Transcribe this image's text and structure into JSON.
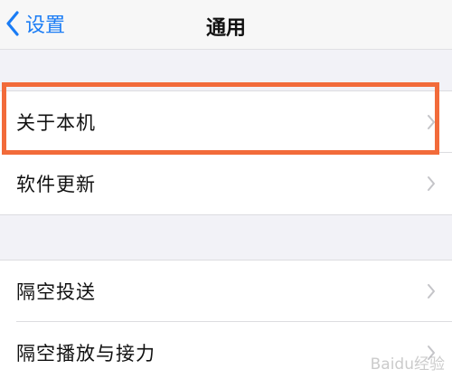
{
  "nav": {
    "back_label": "设置",
    "title": "通用"
  },
  "groups": [
    {
      "items": [
        {
          "label": "关于本机"
        },
        {
          "label": "软件更新"
        }
      ]
    },
    {
      "items": [
        {
          "label": "隔空投送"
        },
        {
          "label": "隔空播放与接力"
        }
      ]
    }
  ],
  "colors": {
    "accent": "#1a7cf5",
    "highlight": "#f26b3a",
    "background": "#f2f2f7"
  },
  "watermark": "Baidu经验"
}
